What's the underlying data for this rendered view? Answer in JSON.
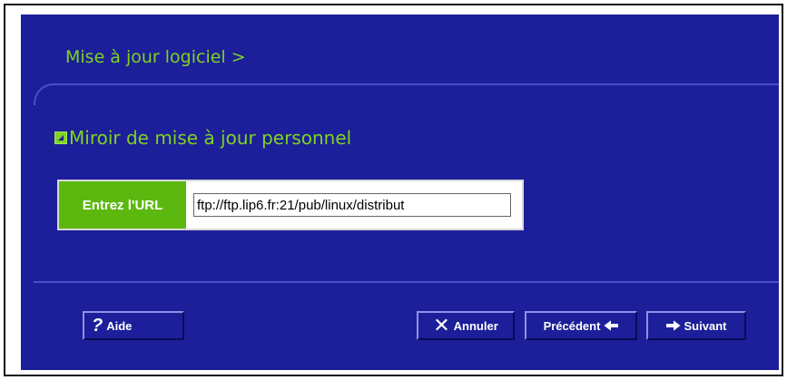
{
  "header": {
    "breadcrumb": "Mise à jour logiciel >"
  },
  "section": {
    "title": "Miroir de mise à jour personnel"
  },
  "url_field": {
    "label": "Entrez l'URL",
    "value": "ftp://ftp.lip6.fr:21/pub/linux/distribut"
  },
  "buttons": {
    "help": "Aide",
    "cancel": "Annuler",
    "previous": "Précédent",
    "next": "Suivant"
  },
  "colors": {
    "panel_bg": "#1c1f99",
    "accent_green": "#7ed321",
    "label_green": "#5cb80f"
  },
  "icons": {
    "help": "question-mark-icon",
    "cancel": "x-icon",
    "previous": "arrow-left-icon",
    "next": "arrow-right-icon",
    "section": "section-bullet-icon"
  }
}
